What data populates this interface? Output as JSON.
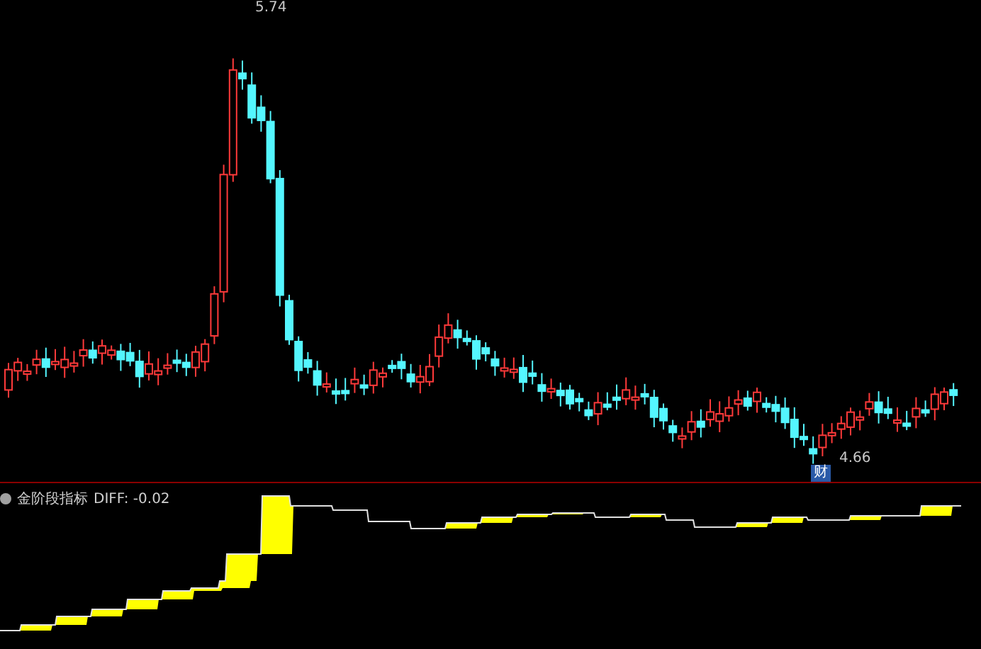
{
  "price_chart": {
    "high_marker": "5.74",
    "low_marker": "4.66",
    "event_badge": "财"
  },
  "indicator": {
    "name": "金阶段指标",
    "reading": "DIFF: -0.02"
  }
}
